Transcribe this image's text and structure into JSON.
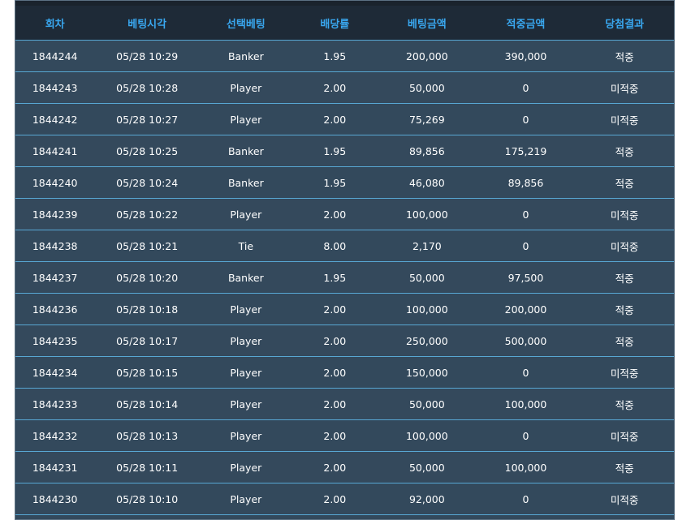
{
  "table": {
    "headers": [
      "회차",
      "베팅시각",
      "선택베팅",
      "배당률",
      "베팅금액",
      "적중금액",
      "당첨결과"
    ],
    "rows": [
      {
        "round": "1844244",
        "time": "05/28 10:29",
        "choice": "Banker",
        "odds": "1.95",
        "amount": "200,000",
        "payout": "390,000",
        "result": "적중",
        "status": "win"
      },
      {
        "round": "1844243",
        "time": "05/28 10:28",
        "choice": "Player",
        "odds": "2.00",
        "amount": "50,000",
        "payout": "0",
        "result": "미적중",
        "status": "lose"
      },
      {
        "round": "1844242",
        "time": "05/28 10:27",
        "choice": "Player",
        "odds": "2.00",
        "amount": "75,269",
        "payout": "0",
        "result": "미적중",
        "status": "lose"
      },
      {
        "round": "1844241",
        "time": "05/28 10:25",
        "choice": "Banker",
        "odds": "1.95",
        "amount": "89,856",
        "payout": "175,219",
        "result": "적중",
        "status": "win"
      },
      {
        "round": "1844240",
        "time": "05/28 10:24",
        "choice": "Banker",
        "odds": "1.95",
        "amount": "46,080",
        "payout": "89,856",
        "result": "적중",
        "status": "win"
      },
      {
        "round": "1844239",
        "time": "05/28 10:22",
        "choice": "Player",
        "odds": "2.00",
        "amount": "100,000",
        "payout": "0",
        "result": "미적중",
        "status": "lose"
      },
      {
        "round": "1844238",
        "time": "05/28 10:21",
        "choice": "Tie",
        "odds": "8.00",
        "amount": "2,170",
        "payout": "0",
        "result": "미적중",
        "status": "lose"
      },
      {
        "round": "1844237",
        "time": "05/28 10:20",
        "choice": "Banker",
        "odds": "1.95",
        "amount": "50,000",
        "payout": "97,500",
        "result": "적중",
        "status": "win"
      },
      {
        "round": "1844236",
        "time": "05/28 10:18",
        "choice": "Player",
        "odds": "2.00",
        "amount": "100,000",
        "payout": "200,000",
        "result": "적중",
        "status": "win"
      },
      {
        "round": "1844235",
        "time": "05/28 10:17",
        "choice": "Player",
        "odds": "2.00",
        "amount": "250,000",
        "payout": "500,000",
        "result": "적중",
        "status": "win"
      },
      {
        "round": "1844234",
        "time": "05/28 10:15",
        "choice": "Player",
        "odds": "2.00",
        "amount": "150,000",
        "payout": "0",
        "result": "미적중",
        "status": "lose"
      },
      {
        "round": "1844233",
        "time": "05/28 10:14",
        "choice": "Player",
        "odds": "2.00",
        "amount": "50,000",
        "payout": "100,000",
        "result": "적중",
        "status": "win"
      },
      {
        "round": "1844232",
        "time": "05/28 10:13",
        "choice": "Player",
        "odds": "2.00",
        "amount": "100,000",
        "payout": "0",
        "result": "미적중",
        "status": "lose"
      },
      {
        "round": "1844231",
        "time": "05/28 10:11",
        "choice": "Player",
        "odds": "2.00",
        "amount": "50,000",
        "payout": "100,000",
        "result": "적중",
        "status": "win"
      },
      {
        "round": "1844230",
        "time": "05/28 10:10",
        "choice": "Player",
        "odds": "2.00",
        "amount": "92,000",
        "payout": "0",
        "result": "미적중",
        "status": "lose"
      }
    ]
  },
  "colors": {
    "header_bg": "#1e2a37",
    "header_text": "#39a7ef",
    "row_bg": "#33495c",
    "row_divider": "#58a7d3",
    "win": "#f5a41e",
    "lose": "#e11e2a"
  }
}
